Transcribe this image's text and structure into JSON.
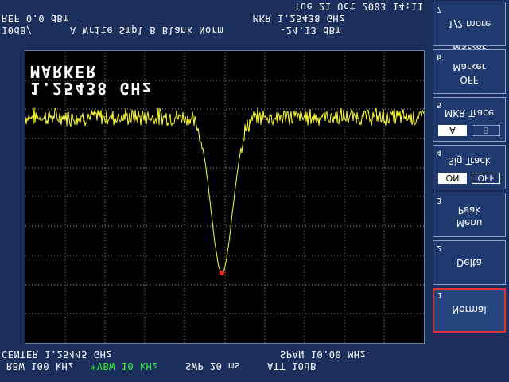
{
  "header": {
    "rbw": "RBW 100 kHz",
    "vbw": "*VBW 10 kHz",
    "swp": "SWP 20 ms",
    "att": "ATT 10dB",
    "center": "CENTER 1.25445 GHz",
    "span": "SPAN 10.00 MHz"
  },
  "marker_readout": {
    "title": "MARKER",
    "freq": "1.25438 GHz"
  },
  "footer": {
    "scale": "10dB/",
    "trace_modes": "A_Write  Smpl  B_Blank  Norm",
    "marker_level": "-24.13 dBm",
    "ref": "REF 0.0 dBm",
    "mkr_freq": "MKR 1.25438 GHz",
    "datetime": "Tue 21 Oct 2003 14:11"
  },
  "softkeys": {
    "k1": {
      "num": "1",
      "label": "Normal"
    },
    "k2": {
      "num": "2",
      "label": "Delta"
    },
    "k3": {
      "num": "3",
      "line1": "Peak",
      "line2": "Menu"
    },
    "k4": {
      "num": "4",
      "label": "Sig Track",
      "on": "ON",
      "off": "OFF"
    },
    "k5": {
      "num": "5",
      "label": "MKR Trace",
      "a": "A",
      "b": "B"
    },
    "k6": {
      "num": "6",
      "line1": "Marker",
      "line2": "OFF"
    },
    "k7": {
      "num": "7",
      "label": "1/2 more"
    },
    "panel_title": "Marker"
  },
  "trace": {
    "color": "#ffff33",
    "marker_color": "#ff2020"
  }
}
